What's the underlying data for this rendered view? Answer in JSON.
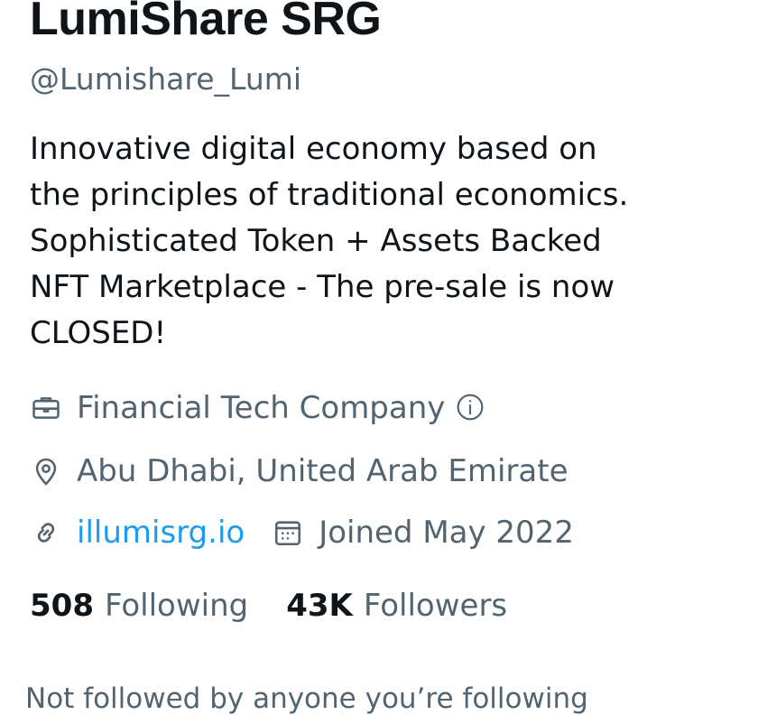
{
  "profile": {
    "display_name": "LumiShare SRG",
    "handle": "@Lumishare_Lumi",
    "bio_lines": [
      "Innovative digital economy based on",
      "the principles of traditional economics.",
      "Sophisticated Token + Assets Backed",
      "NFT Marketplace - The pre-sale is now",
      "CLOSED!"
    ],
    "category": "Financial Tech Company",
    "location": "Abu Dhabi, United Arab Emirate",
    "website": "illumisrg.io",
    "joined": "Joined May 2022",
    "following_count": "508",
    "following_label": "Following",
    "followers_count": "43K",
    "followers_label": "Followers",
    "followed_by_text": "Not followed by anyone you’re following"
  },
  "icons": {
    "category": "briefcase-icon",
    "category_info": "info-icon",
    "location": "location-pin-icon",
    "website": "link-icon",
    "joined": "calendar-icon"
  },
  "colors": {
    "primary_text": "#0f1419",
    "secondary_text": "#536471",
    "link": "#1d9bf0",
    "background": "#ffffff"
  }
}
